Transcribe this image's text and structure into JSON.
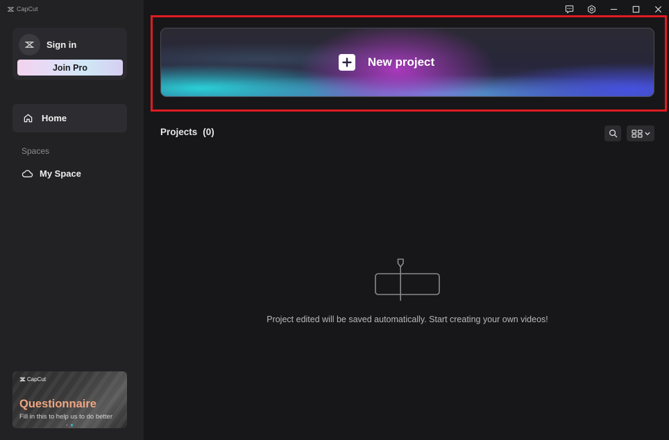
{
  "app": {
    "brand": "CapCut"
  },
  "sidebar": {
    "account": {
      "sign_in_label": "Sign in",
      "join_pro_label": "Join Pro"
    },
    "nav": {
      "home_label": "Home"
    },
    "spaces": {
      "heading": "Spaces",
      "my_space_label": "My Space"
    },
    "promo": {
      "brand": "CapCut",
      "title": "Questionnaire",
      "subtitle": "Fill in this to help us to do better",
      "title_color": "#f0a582"
    }
  },
  "main": {
    "new_project_label": "New project",
    "projects": {
      "label": "Projects",
      "count": "(0)"
    },
    "empty_message": "Project edited will be saved automatically. Start creating your own videos!"
  },
  "colors": {
    "highlight": "#e01b22",
    "sidebar_bg": "#222225",
    "main_bg": "#171719"
  }
}
